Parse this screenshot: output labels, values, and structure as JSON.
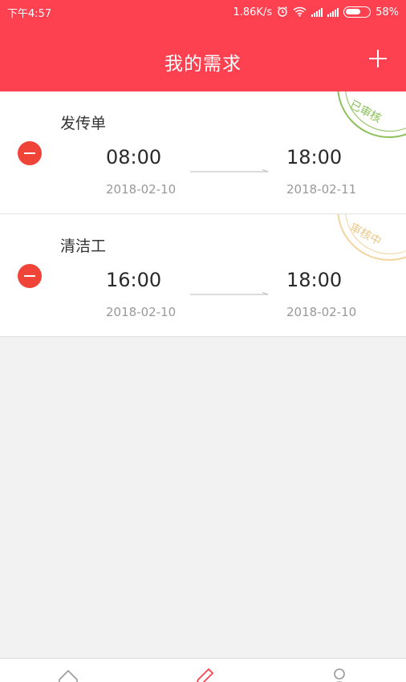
{
  "status_bar": {
    "time": "下午4:57",
    "network_speed": "1.86K/s",
    "battery": "58%",
    "icons": [
      "alarm-icon",
      "wifi-icon",
      "signal-icon",
      "signal-icon",
      "battery-icon"
    ]
  },
  "header": {
    "title": "我的需求",
    "add_icon": "plus-icon"
  },
  "requests": [
    {
      "name": "发传单",
      "start_time": "08:00",
      "start_date": "2018-02-10",
      "end_time": "18:00",
      "end_date": "2018-02-11",
      "status": "已审核",
      "status_color": "#8bc05a"
    },
    {
      "name": "清洁工",
      "start_time": "16:00",
      "start_date": "2018-02-10",
      "end_time": "18:00",
      "end_date": "2018-02-10",
      "status": "审核中",
      "status_color": "#e9c98b"
    }
  ],
  "tab_bar": {
    "items": [
      {
        "icon": "home-icon",
        "active": false
      },
      {
        "icon": "pencil-icon",
        "active": true
      },
      {
        "icon": "user-icon",
        "active": false
      }
    ]
  },
  "colors": {
    "brand": "#fd4150",
    "remove": "#f04438"
  }
}
